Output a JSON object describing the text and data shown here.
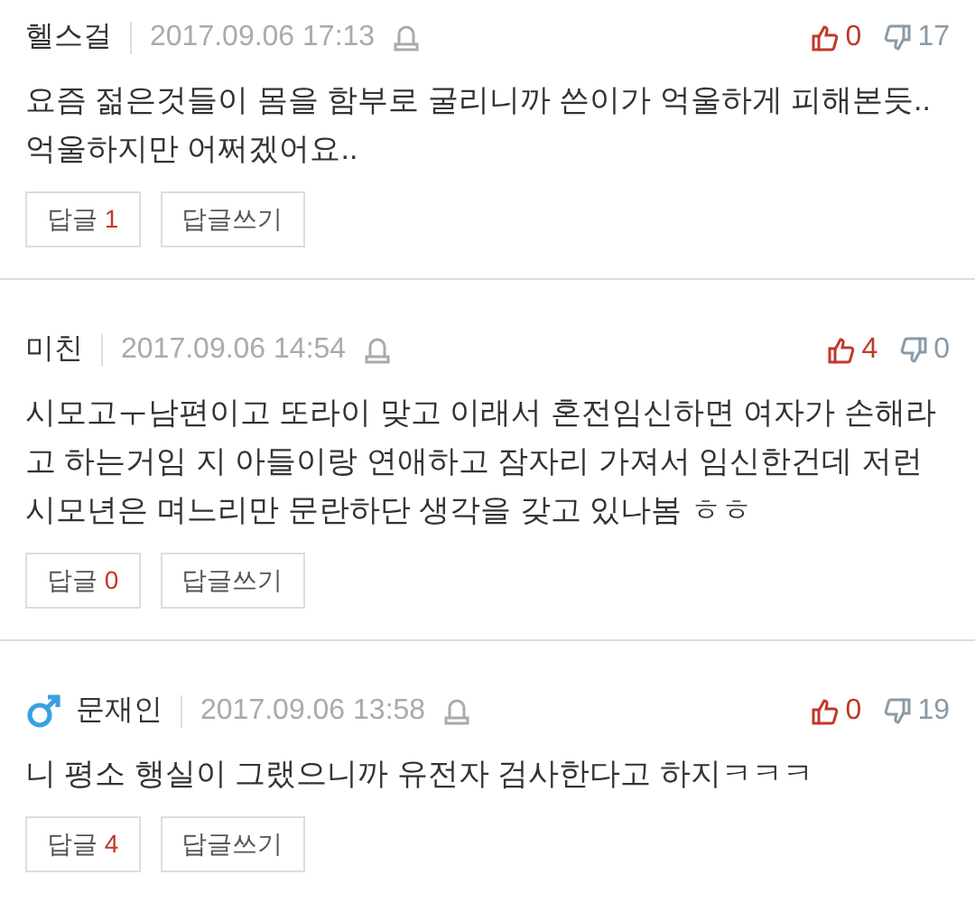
{
  "comments": [
    {
      "author": "헬스걸",
      "male_icon": false,
      "date": "2017.09.06 17:13",
      "likes": "0",
      "dislikes": "17",
      "text": "요즘 젊은것들이 몸을 함부로 굴리니까 쓴이가 억울하게 피해본듯..억울하지만 어쩌겠어요..",
      "reply_label": "답글",
      "reply_count": "1",
      "write_label": "답글쓰기"
    },
    {
      "author": "미친",
      "male_icon": false,
      "date": "2017.09.06 14:54",
      "likes": "4",
      "dislikes": "0",
      "text": "시모고ㅜ남편이고 또라이 맞고 이래서 혼전임신하면 여자가 손해라고 하는거임 지 아들이랑 연애하고 잠자리 가져서 임신한건데 저런 시모년은 며느리만 문란하단 생각을 갖고 있나봄 ㅎㅎ",
      "reply_label": "답글",
      "reply_count": "0",
      "write_label": "답글쓰기"
    },
    {
      "author": "문재인",
      "male_icon": true,
      "date": "2017.09.06 13:58",
      "likes": "0",
      "dislikes": "19",
      "text": "니 평소 행실이 그랬으니까 유전자 검사한다고 하지ㅋㅋㅋ",
      "reply_label": "답글",
      "reply_count": "4",
      "write_label": "답글쓰기"
    }
  ]
}
